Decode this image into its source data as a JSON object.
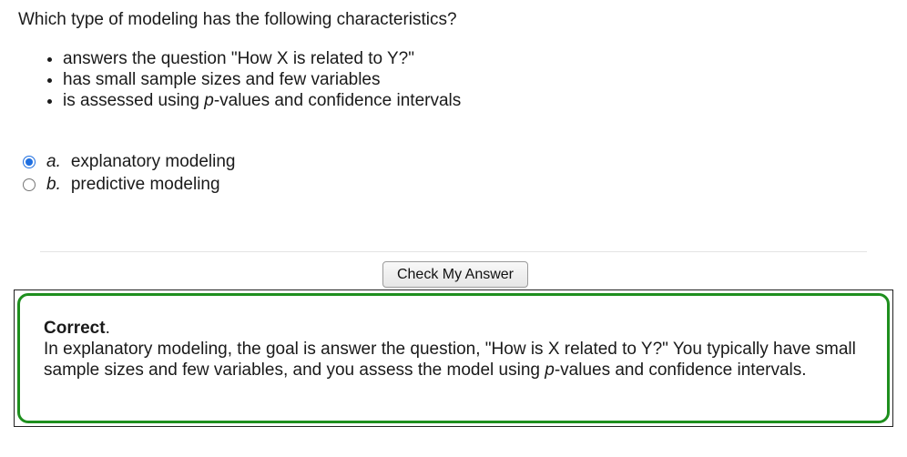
{
  "question": {
    "text": "Which type of modeling has the following characteristics?",
    "bullets": [
      {
        "text": "answers the question \"How X is related to Y?\""
      },
      {
        "text": "has small sample sizes and few variables"
      },
      {
        "pre": "is assessed using ",
        "em": "p",
        "post": "-values and confidence intervals"
      }
    ]
  },
  "options": [
    {
      "letter": "a.",
      "label": "explanatory modeling",
      "selected": true
    },
    {
      "letter": "b.",
      "label": "predictive modeling",
      "selected": false
    }
  ],
  "check_button": {
    "label": "Check My Answer"
  },
  "feedback": {
    "status": "Correct",
    "status_suffix": ".",
    "text_pre": "In explanatory modeling, the goal is answer the question, \"How is X related to Y?\" You typically have small sample sizes and few variables, and you assess the model using ",
    "text_em": "p",
    "text_post": "-values and confidence intervals.",
    "border_color": "#1e8f1e"
  },
  "colors": {
    "radio_selected": "#1f6fe0"
  }
}
